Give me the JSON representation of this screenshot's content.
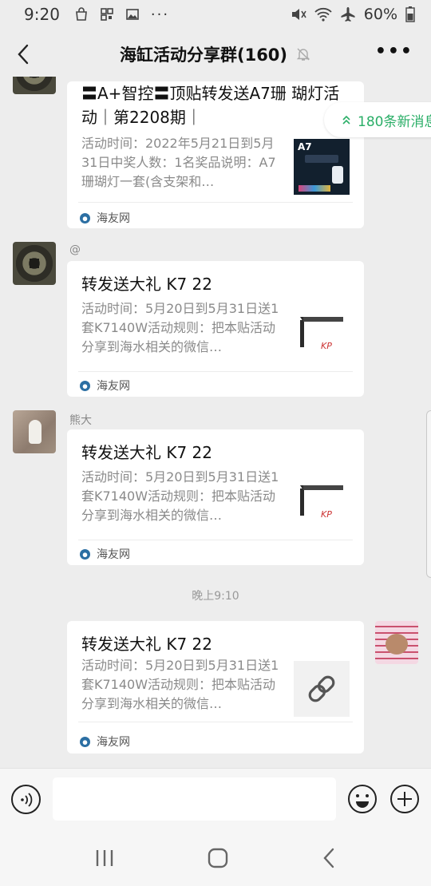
{
  "status_bar": {
    "time": "9:20",
    "battery": "60%"
  },
  "nav": {
    "title": "海缸活动分享群(160)",
    "more": "•••"
  },
  "new_messages_pill": {
    "label": "180条新消息"
  },
  "messages": [
    {
      "sender": "",
      "title": "〓A+智控〓顶贴转发送A7珊 瑚灯活动｜第2208期｜",
      "desc": "活动时间：2022年5月21日到5月31日中奖人数：1名奖品说明：A7珊瑚灯一套(含支架和…",
      "source": "海友网",
      "thumb_label": "A7"
    },
    {
      "sender": "@",
      "title": "转发送大礼 K7 22",
      "desc": "活动时间：5月20日到5月31日送1套K7140W活动规则：把本贴活动分享到海水相关的微信…",
      "source": "海友网",
      "thumb_label": "KP"
    },
    {
      "sender": "熊大",
      "title": "转发送大礼 K7 22",
      "desc": "活动时间：5月20日到5月31日送1套K7140W活动规则：把本贴活动分享到海水相关的微信…",
      "source": "海友网",
      "thumb_label": "KP"
    },
    {
      "sender": "",
      "title": "转发送大礼 K7 22",
      "desc": "活动时间：5月20日到5月31日送1套K7140W活动规则：把本贴活动分享到海水相关的微信…",
      "source": "海友网",
      "thumb_label": ""
    }
  ],
  "timestamp": "晚上9:10",
  "input": {
    "value": ""
  },
  "colors": {
    "accent_green": "#2aae67",
    "chat_bg": "#ededed"
  }
}
